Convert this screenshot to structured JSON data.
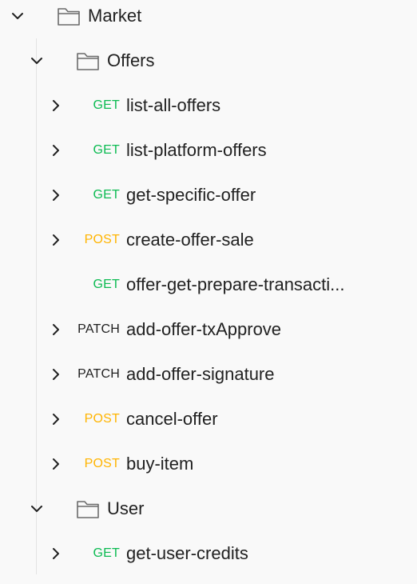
{
  "tree": {
    "collection": {
      "label": "Market",
      "expanded": true,
      "folders": [
        {
          "label": "Offers",
          "expanded": true,
          "requests": [
            {
              "method": "GET",
              "label": "list-all-offers",
              "has_children": true
            },
            {
              "method": "GET",
              "label": "list-platform-offers",
              "has_children": true
            },
            {
              "method": "GET",
              "label": "get-specific-offer",
              "has_children": true
            },
            {
              "method": "POST",
              "label": "create-offer-sale",
              "has_children": true
            },
            {
              "method": "GET",
              "label": "offer-get-prepare-transacti...",
              "has_children": false
            },
            {
              "method": "PATCH",
              "label": "add-offer-txApprove",
              "has_children": true
            },
            {
              "method": "PATCH",
              "label": "add-offer-signature",
              "has_children": true
            },
            {
              "method": "POST",
              "label": "cancel-offer",
              "has_children": true
            },
            {
              "method": "POST",
              "label": "buy-item",
              "has_children": true
            }
          ]
        },
        {
          "label": "User",
          "expanded": true,
          "requests": [
            {
              "method": "GET",
              "label": "get-user-credits",
              "has_children": true
            }
          ]
        }
      ]
    }
  },
  "icons": {
    "chevron_down": "chevron-down-icon",
    "chevron_right": "chevron-right-icon",
    "folder": "folder-icon"
  },
  "colors": {
    "background": "#f9f9f9",
    "text": "#212121",
    "get": "#0cbb52",
    "post": "#ffb400",
    "patch": "#212121",
    "guide": "#e3e3e3"
  }
}
